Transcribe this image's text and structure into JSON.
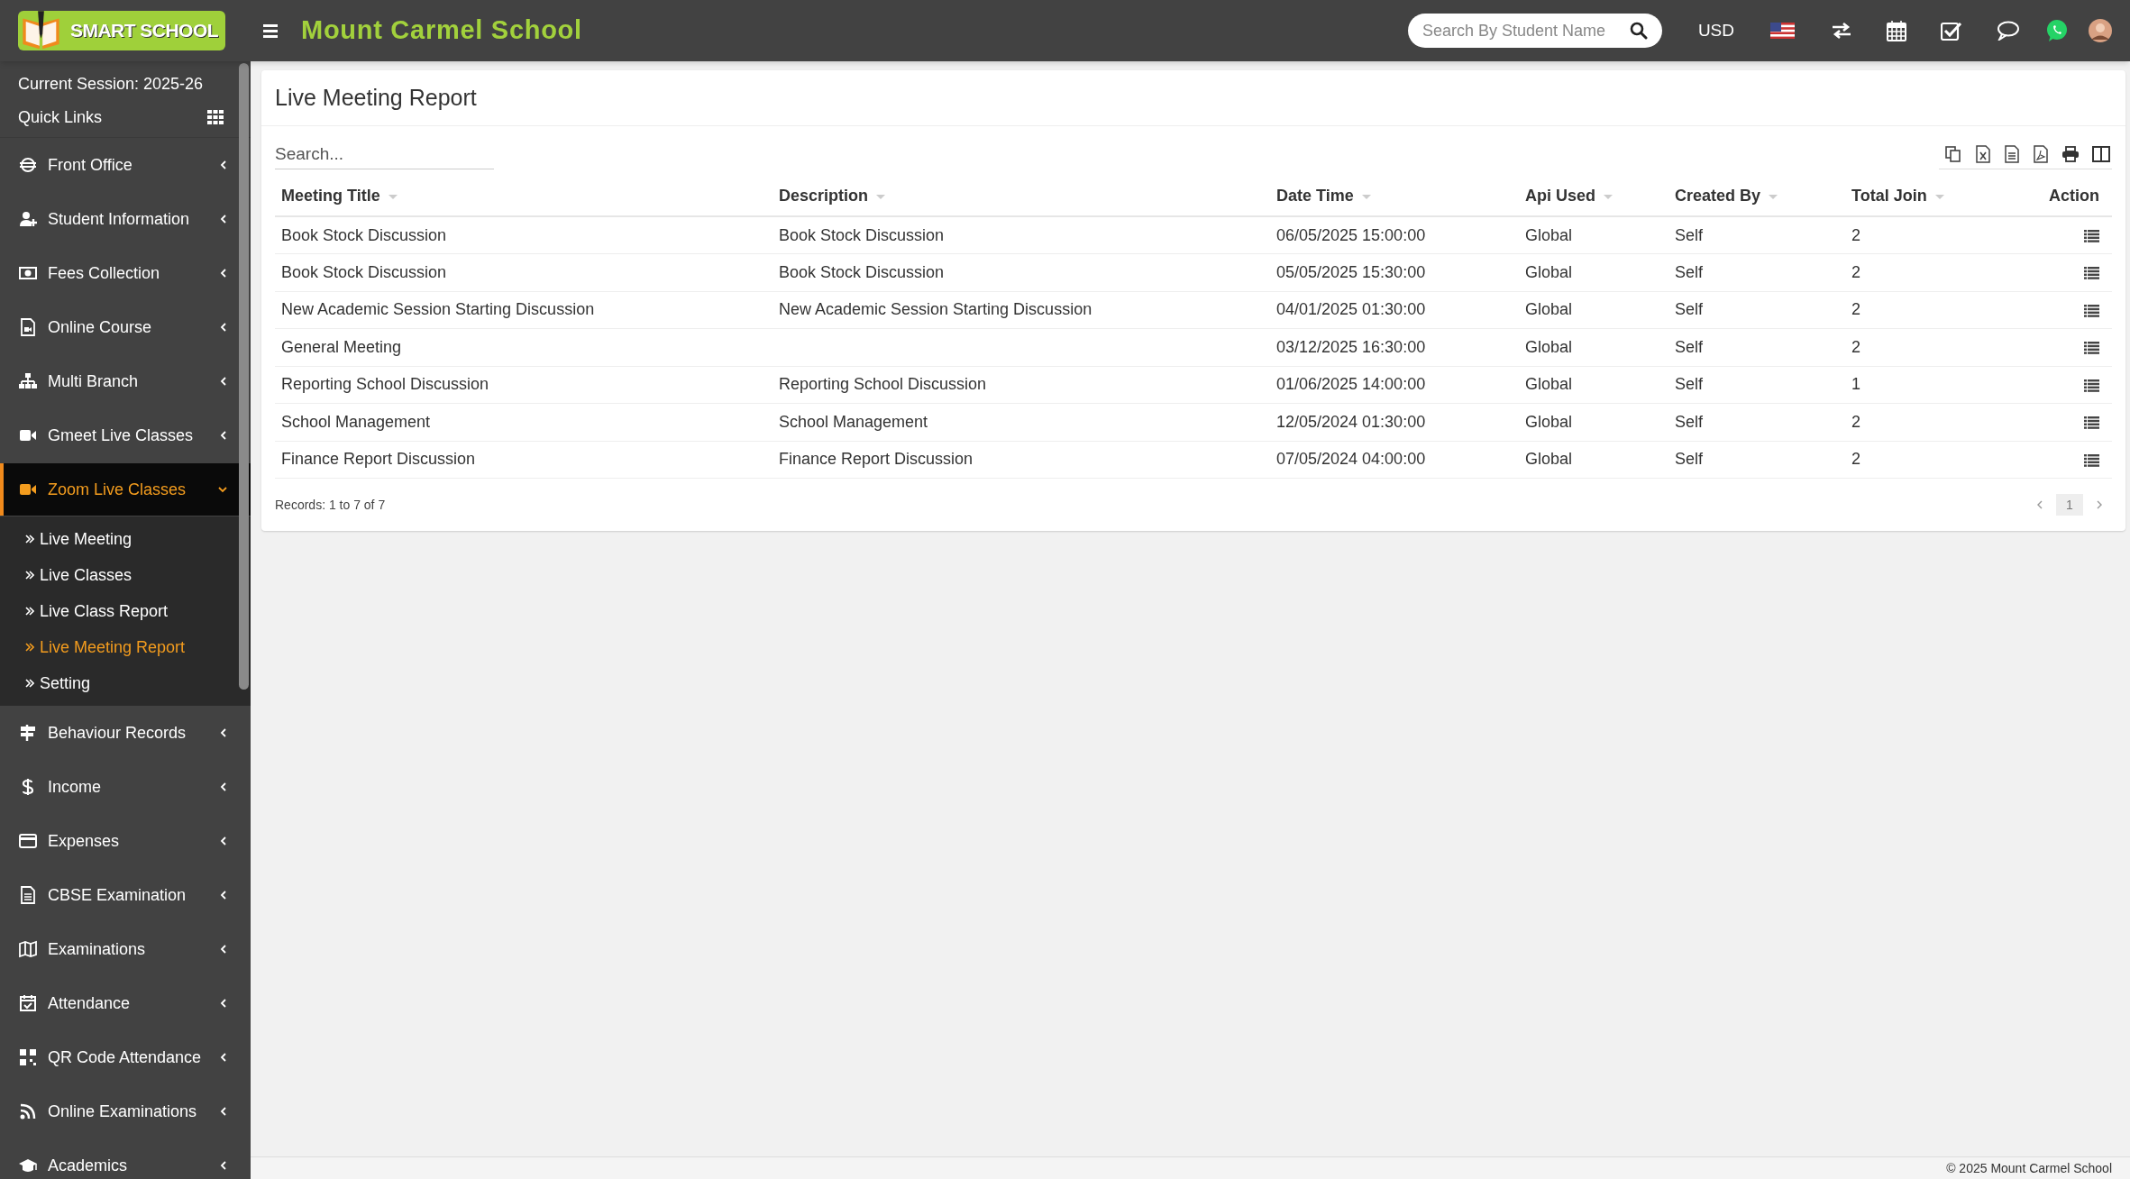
{
  "header": {
    "logo_text": "SMART SCHOOL",
    "school_name": "Mount Carmel School",
    "search": {
      "placeholder": "Search By Student Name"
    },
    "currency": "USD"
  },
  "sidebar": {
    "session": "Current Session: 2025-26",
    "quick_links": "Quick Links",
    "items": [
      {
        "label": "Front Office",
        "selected": false,
        "expanded": false
      },
      {
        "label": "Student Information",
        "selected": false,
        "expanded": false
      },
      {
        "label": "Fees Collection",
        "selected": false,
        "expanded": false
      },
      {
        "label": "Online Course",
        "selected": false,
        "expanded": false
      },
      {
        "label": "Multi Branch",
        "selected": false,
        "expanded": false
      },
      {
        "label": "Gmeet Live Classes",
        "selected": false,
        "expanded": false
      },
      {
        "label": "Zoom Live Classes",
        "selected": true,
        "expanded": true,
        "children": [
          {
            "label": "Live Meeting",
            "selected": false
          },
          {
            "label": "Live Classes",
            "selected": false
          },
          {
            "label": "Live Class Report",
            "selected": false
          },
          {
            "label": "Live Meeting Report",
            "selected": true
          },
          {
            "label": "Setting",
            "selected": false
          }
        ]
      },
      {
        "label": "Behaviour Records",
        "selected": false,
        "expanded": false
      },
      {
        "label": "Income",
        "selected": false,
        "expanded": false
      },
      {
        "label": "Expenses",
        "selected": false,
        "expanded": false
      },
      {
        "label": "CBSE Examination",
        "selected": false,
        "expanded": false
      },
      {
        "label": "Examinations",
        "selected": false,
        "expanded": false
      },
      {
        "label": "Attendance",
        "selected": false,
        "expanded": false
      },
      {
        "label": "QR Code Attendance",
        "selected": false,
        "expanded": false
      },
      {
        "label": "Online Examinations",
        "selected": false,
        "expanded": false
      },
      {
        "label": "Academics",
        "selected": false,
        "expanded": false
      }
    ]
  },
  "report": {
    "title": "Live Meeting Report",
    "search": {
      "placeholder": "Search..."
    },
    "columns": [
      {
        "label": "Meeting Title",
        "sortable": true
      },
      {
        "label": "Description",
        "sortable": true
      },
      {
        "label": "Date Time",
        "sortable": true
      },
      {
        "label": "Api Used",
        "sortable": true
      },
      {
        "label": "Created By",
        "sortable": true
      },
      {
        "label": "Total Join",
        "sortable": true
      },
      {
        "label": "Action",
        "sortable": false
      }
    ],
    "rows": [
      {
        "meeting_title": "Book Stock Discussion",
        "description": "Book Stock Discussion",
        "date_time": "06/05/2025 15:00:00",
        "api_used": "Global",
        "created_by": "Self",
        "total_join": "2"
      },
      {
        "meeting_title": "Book Stock Discussion",
        "description": "Book Stock Discussion",
        "date_time": "05/05/2025 15:30:00",
        "api_used": "Global",
        "created_by": "Self",
        "total_join": "2"
      },
      {
        "meeting_title": "New Academic Session Starting Discussion",
        "description": "New Academic Session Starting Discussion",
        "date_time": "04/01/2025 01:30:00",
        "api_used": "Global",
        "created_by": "Self",
        "total_join": "2"
      },
      {
        "meeting_title": "General Meeting",
        "date_time": "03/12/2025 16:30:00",
        "api_used": "Global",
        "created_by": "Self",
        "total_join": "2"
      },
      {
        "meeting_title": "Reporting School Discussion",
        "description": "Reporting School Discussion",
        "date_time": "01/06/2025 14:00:00",
        "api_used": "Global",
        "created_by": "Self",
        "total_join": "1"
      },
      {
        "meeting_title": "School Management",
        "description": "School Management",
        "date_time": "12/05/2024 01:30:00",
        "api_used": "Global",
        "created_by": "Self",
        "total_join": "2"
      },
      {
        "meeting_title": "Finance Report Discussion",
        "description": "Finance Report Discussion",
        "date_time": "07/05/2024 04:00:00",
        "api_used": "Global",
        "created_by": "Self",
        "total_join": "2"
      }
    ],
    "records": "Records: 1 to 7 of 7",
    "pages": [
      {
        "label": "1",
        "selected": true
      }
    ]
  },
  "footer": "© 2025 Mount Carmel School"
}
